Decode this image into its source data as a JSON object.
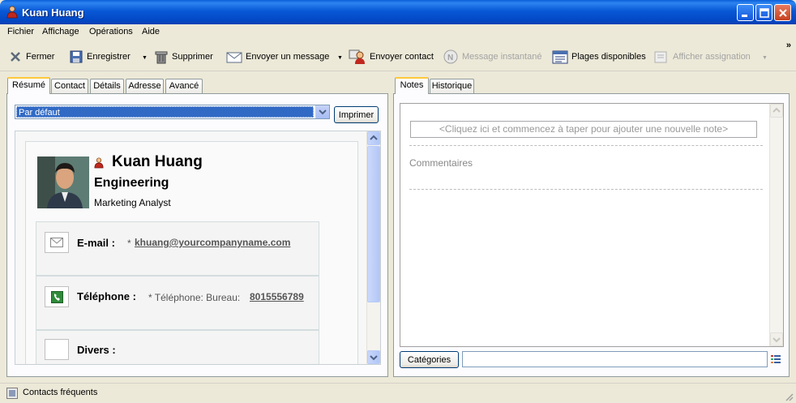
{
  "window": {
    "title": "Kuan Huang"
  },
  "menu": [
    "Fichier",
    "Affichage",
    "Opérations",
    "Aide"
  ],
  "toolbar": {
    "close": "Fermer",
    "save": "Enregistrer",
    "delete": "Supprimer",
    "send_message": "Envoyer un message",
    "send_contact": "Envoyer contact",
    "instant_message": "Message instantané",
    "availability": "Plages disponibles",
    "show_assignment": "Afficher assignation"
  },
  "left_tabs": [
    "Résumé",
    "Contact",
    "Détails",
    "Adresse",
    "Avancé"
  ],
  "view_select": {
    "value": "Par défaut"
  },
  "print_button": "Imprimer",
  "contact": {
    "name": "Kuan Huang",
    "department": "Engineering",
    "job_title": "Marketing Analyst",
    "email_label": "E-mail :",
    "email_prefix": "*",
    "email": "khuang@yourcompanyname.com",
    "phone_label": "Téléphone :",
    "phone_prefix": "* Téléphone: Bureau:",
    "phone": "8015556789",
    "misc_label": "Divers :"
  },
  "right_tabs": [
    "Notes",
    "Historique"
  ],
  "notes": {
    "placeholder": "<Cliquez ici et commencez à taper pour ajouter une nouvelle note>",
    "comments_label": "Commentaires"
  },
  "categories_button": "Catégories",
  "status": {
    "text": "Contacts fréquents"
  },
  "colors": {
    "title_bar": "#0A5FD8",
    "link": "#3F6A8A",
    "tab_highlight": "#FFC83C"
  }
}
